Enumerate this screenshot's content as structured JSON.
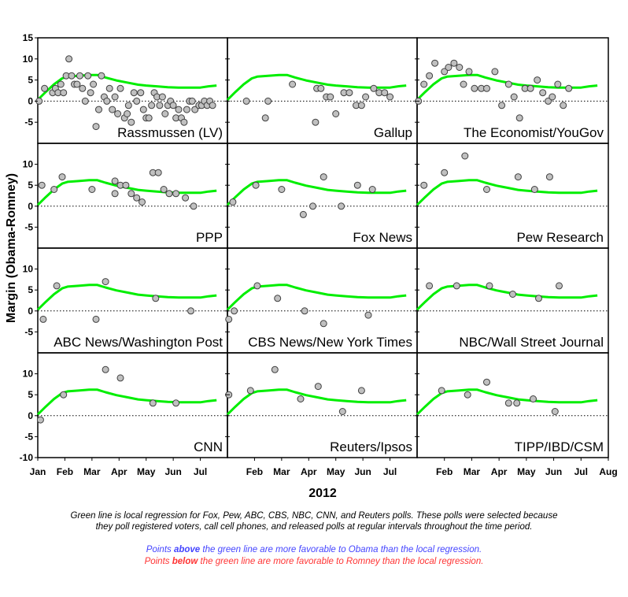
{
  "chart_data": {
    "type": "scatter",
    "layout": "small-multiples 4x3",
    "ylabel": "Margin (Obama-Romney)",
    "xlabel": "2012",
    "x_unit": "month of 2012 (1 = Jan 1, 8 = Aug 1)",
    "xlim": [
      1,
      8
    ],
    "ylim": [
      -10,
      15
    ],
    "yticks": [
      -10,
      -5,
      0,
      5,
      10,
      15
    ],
    "x_ticks": [
      {
        "value": 1,
        "label": "Jan"
      },
      {
        "value": 2,
        "label": "Feb"
      },
      {
        "value": 3,
        "label": "Mar"
      },
      {
        "value": 4,
        "label": "Apr"
      },
      {
        "value": 5,
        "label": "May"
      },
      {
        "value": 6,
        "label": "Jun"
      },
      {
        "value": 7,
        "label": "Jul"
      },
      {
        "value": 8,
        "label": "Aug"
      }
    ],
    "reference_line": {
      "y": 0,
      "style": "dotted"
    },
    "colors": {
      "regression": "#00ee00",
      "point_fill": "#c0c0c0",
      "point_stroke": "#404040",
      "above": "#4444ff",
      "below": "#ff3333"
    },
    "regression": {
      "name": "Local regression (Fox, Pew, ABC, CBS, NBC, CNN, Reuters)",
      "x": [
        1.0,
        1.3,
        1.6,
        1.9,
        2.1,
        2.5,
        2.9,
        3.2,
        3.5,
        3.9,
        4.3,
        4.7,
        5.0,
        5.4,
        5.8,
        6.2,
        6.6,
        7.0,
        7.3,
        7.6
      ],
      "y": [
        0.3,
        2.2,
        4.0,
        5.4,
        5.8,
        6.0,
        6.2,
        6.2,
        5.6,
        4.9,
        4.4,
        3.9,
        3.7,
        3.5,
        3.3,
        3.2,
        3.2,
        3.2,
        3.5,
        3.7
      ]
    },
    "panels": [
      {
        "name": "Rassmussen (LV)",
        "points": [
          [
            1.05,
            0
          ],
          [
            1.25,
            3
          ],
          [
            1.55,
            2
          ],
          [
            1.65,
            3
          ],
          [
            1.75,
            2
          ],
          [
            1.85,
            4
          ],
          [
            1.95,
            2
          ],
          [
            2.05,
            6
          ],
          [
            2.15,
            10
          ],
          [
            2.25,
            6
          ],
          [
            2.35,
            4
          ],
          [
            2.45,
            4
          ],
          [
            2.55,
            6
          ],
          [
            2.65,
            3
          ],
          [
            2.75,
            0
          ],
          [
            2.85,
            6
          ],
          [
            2.95,
            2
          ],
          [
            3.05,
            4
          ],
          [
            3.15,
            -6
          ],
          [
            3.25,
            -2
          ],
          [
            3.35,
            6
          ],
          [
            3.45,
            1
          ],
          [
            3.55,
            0
          ],
          [
            3.65,
            3
          ],
          [
            3.75,
            -2
          ],
          [
            3.85,
            1
          ],
          [
            3.95,
            -3
          ],
          [
            4.05,
            3
          ],
          [
            4.2,
            -4
          ],
          [
            4.3,
            -3
          ],
          [
            4.35,
            -1
          ],
          [
            4.45,
            -5
          ],
          [
            4.55,
            2
          ],
          [
            4.65,
            0
          ],
          [
            4.8,
            2
          ],
          [
            4.9,
            -2
          ],
          [
            5.0,
            -4
          ],
          [
            5.1,
            -4
          ],
          [
            5.2,
            -1
          ],
          [
            5.3,
            2
          ],
          [
            5.4,
            1
          ],
          [
            5.5,
            -1
          ],
          [
            5.6,
            1
          ],
          [
            5.7,
            -3
          ],
          [
            5.8,
            -1
          ],
          [
            5.9,
            0
          ],
          [
            6.0,
            -1
          ],
          [
            6.1,
            -4
          ],
          [
            6.2,
            -2
          ],
          [
            6.3,
            -4
          ],
          [
            6.4,
            -5
          ],
          [
            6.5,
            -2
          ],
          [
            6.6,
            0
          ],
          [
            6.7,
            0
          ],
          [
            6.8,
            -2
          ],
          [
            6.95,
            -1
          ],
          [
            7.05,
            -1
          ],
          [
            7.15,
            0
          ],
          [
            7.25,
            -1
          ],
          [
            7.35,
            0
          ],
          [
            7.45,
            -1
          ]
        ]
      },
      {
        "name": "Gallup",
        "points": [
          [
            1.7,
            0
          ],
          [
            2.4,
            -4
          ],
          [
            2.5,
            0
          ],
          [
            3.4,
            4
          ],
          [
            4.25,
            -5
          ],
          [
            4.3,
            3
          ],
          [
            4.45,
            3
          ],
          [
            4.65,
            1
          ],
          [
            4.8,
            1
          ],
          [
            5.0,
            -3
          ],
          [
            5.3,
            2
          ],
          [
            5.5,
            2
          ],
          [
            5.75,
            -1
          ],
          [
            5.95,
            -1
          ],
          [
            6.1,
            1
          ],
          [
            6.4,
            3
          ],
          [
            6.6,
            2
          ],
          [
            6.8,
            2
          ],
          [
            7.0,
            1
          ]
        ]
      },
      {
        "name": "The Economist/YouGov",
        "points": [
          [
            1.05,
            0
          ],
          [
            1.25,
            4
          ],
          [
            1.45,
            6
          ],
          [
            1.65,
            9
          ],
          [
            2.0,
            7
          ],
          [
            2.15,
            8
          ],
          [
            2.35,
            9
          ],
          [
            2.55,
            8
          ],
          [
            2.7,
            4
          ],
          [
            2.9,
            7
          ],
          [
            3.1,
            3
          ],
          [
            3.35,
            3
          ],
          [
            3.55,
            3
          ],
          [
            3.85,
            7
          ],
          [
            4.1,
            -1
          ],
          [
            4.35,
            4
          ],
          [
            4.55,
            1
          ],
          [
            4.75,
            -4
          ],
          [
            4.95,
            3
          ],
          [
            5.15,
            3
          ],
          [
            5.4,
            5
          ],
          [
            5.6,
            2
          ],
          [
            5.8,
            0
          ],
          [
            5.95,
            1
          ],
          [
            6.15,
            4
          ],
          [
            6.35,
            -1
          ],
          [
            6.55,
            3
          ]
        ]
      },
      {
        "name": "PPP",
        "points": [
          [
            1.15,
            5
          ],
          [
            1.6,
            4
          ],
          [
            1.9,
            7
          ],
          [
            3.0,
            4
          ],
          [
            3.85,
            6
          ],
          [
            3.85,
            3
          ],
          [
            4.05,
            5
          ],
          [
            4.25,
            5
          ],
          [
            4.45,
            3
          ],
          [
            4.65,
            2
          ],
          [
            4.85,
            1
          ],
          [
            5.25,
            8
          ],
          [
            5.45,
            8
          ],
          [
            5.65,
            4
          ],
          [
            5.85,
            3
          ],
          [
            6.1,
            3
          ],
          [
            6.45,
            2
          ],
          [
            6.75,
            0
          ]
        ]
      },
      {
        "name": "Fox News",
        "points": [
          [
            1.2,
            1
          ],
          [
            2.05,
            5
          ],
          [
            3.0,
            4
          ],
          [
            3.8,
            -2
          ],
          [
            4.15,
            0
          ],
          [
            4.55,
            7
          ],
          [
            5.2,
            0
          ],
          [
            5.8,
            5
          ],
          [
            6.35,
            4
          ]
        ]
      },
      {
        "name": "Pew Research",
        "points": [
          [
            1.25,
            5
          ],
          [
            2.0,
            8
          ],
          [
            2.75,
            12
          ],
          [
            3.55,
            4
          ],
          [
            4.7,
            7
          ],
          [
            5.3,
            4
          ],
          [
            5.85,
            7
          ]
        ]
      },
      {
        "name": "ABC News/Washington Post",
        "points": [
          [
            1.2,
            -2
          ],
          [
            1.7,
            6
          ],
          [
            3.15,
            -2
          ],
          [
            3.5,
            7
          ],
          [
            5.35,
            3
          ],
          [
            6.65,
            0
          ]
        ]
      },
      {
        "name": "CBS News/New York Times",
        "points": [
          [
            1.05,
            -2
          ],
          [
            1.25,
            0
          ],
          [
            2.1,
            6
          ],
          [
            2.85,
            3
          ],
          [
            3.85,
            0
          ],
          [
            4.55,
            -3
          ],
          [
            6.2,
            -1
          ]
        ]
      },
      {
        "name": "NBC/Wall Street Journal",
        "points": [
          [
            1.45,
            6
          ],
          [
            2.45,
            6
          ],
          [
            3.65,
            6
          ],
          [
            4.5,
            4
          ],
          [
            5.45,
            3
          ],
          [
            6.2,
            6
          ]
        ]
      },
      {
        "name": "CNN",
        "points": [
          [
            1.1,
            -1
          ],
          [
            1.95,
            5
          ],
          [
            3.5,
            11
          ],
          [
            4.05,
            9
          ],
          [
            5.25,
            3
          ],
          [
            6.1,
            3
          ]
        ]
      },
      {
        "name": "Reuters/Ipsos",
        "points": [
          [
            1.05,
            5
          ],
          [
            1.85,
            6
          ],
          [
            2.75,
            11
          ],
          [
            3.7,
            4
          ],
          [
            4.35,
            7
          ],
          [
            5.25,
            1
          ],
          [
            5.95,
            6
          ]
        ]
      },
      {
        "name": "TIPP/IBD/CSM",
        "points": [
          [
            1.9,
            6
          ],
          [
            2.85,
            5
          ],
          [
            3.55,
            8
          ],
          [
            4.35,
            3
          ],
          [
            4.65,
            3
          ],
          [
            5.25,
            4
          ],
          [
            6.05,
            1
          ]
        ]
      }
    ]
  },
  "captions": {
    "main_line1": "Green line is local regression for Fox, Pew, ABC, CBS, NBC, CNN, and Reuters polls.  These polls were selected because",
    "main_line2": "they poll registered voters, call cell phones, and released polls at regular intervals throughout the time period.",
    "above_prefix": "Points ",
    "above_bold": "above",
    "above_suffix": " the green line are more favorable to Obama than the local regression.",
    "below_prefix": "Points ",
    "below_bold": "below",
    "below_suffix": " the green line are more favorable to Romney than the local regression."
  }
}
